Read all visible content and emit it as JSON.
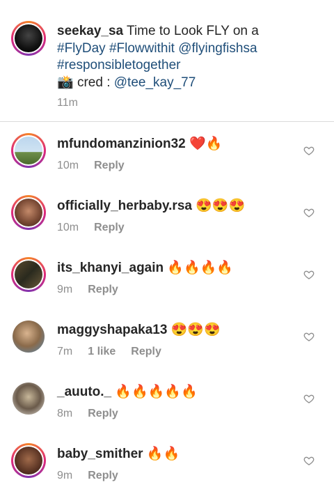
{
  "caption": {
    "username": "seekay_sa",
    "text_start": " Time to Look FLY on a",
    "hashtag1": "#FlyDay",
    "hashtag2": "#Flowwithit",
    "mention1": "@flyingfishsa",
    "hashtag3": "#responsibletogether",
    "camera_emoji": "📸",
    "cred_text": " cred : ",
    "mention2": "@tee_kay_77",
    "time": "11m"
  },
  "comments": [
    {
      "username": "mfundomanzinion32",
      "emoji": "❤️🔥",
      "time": "10m",
      "likes": "",
      "reply": "Reply"
    },
    {
      "username": "officially_herbaby.rsa",
      "emoji": "😍😍😍",
      "time": "10m",
      "likes": "",
      "reply": "Reply"
    },
    {
      "username": "its_khanyi_again",
      "emoji": "🔥🔥🔥🔥",
      "time": "9m",
      "likes": "",
      "reply": "Reply"
    },
    {
      "username": "maggyshapaka13",
      "emoji": "😍😍😍",
      "time": "7m",
      "likes": "1 like",
      "reply": "Reply"
    },
    {
      "username": "_auuto._",
      "emoji": "🔥🔥🔥🔥🔥",
      "time": "8m",
      "likes": "",
      "reply": "Reply"
    },
    {
      "username": "baby_smither",
      "emoji": "🔥🔥",
      "time": "9m",
      "likes": "",
      "reply": "Reply"
    }
  ],
  "icons": {
    "like": "heart-outline-icon"
  },
  "colors": {
    "link": "#1f4e79",
    "meta": "#8e8e8e",
    "ring_start": "#f58529",
    "ring_end": "#dd2a7b"
  }
}
